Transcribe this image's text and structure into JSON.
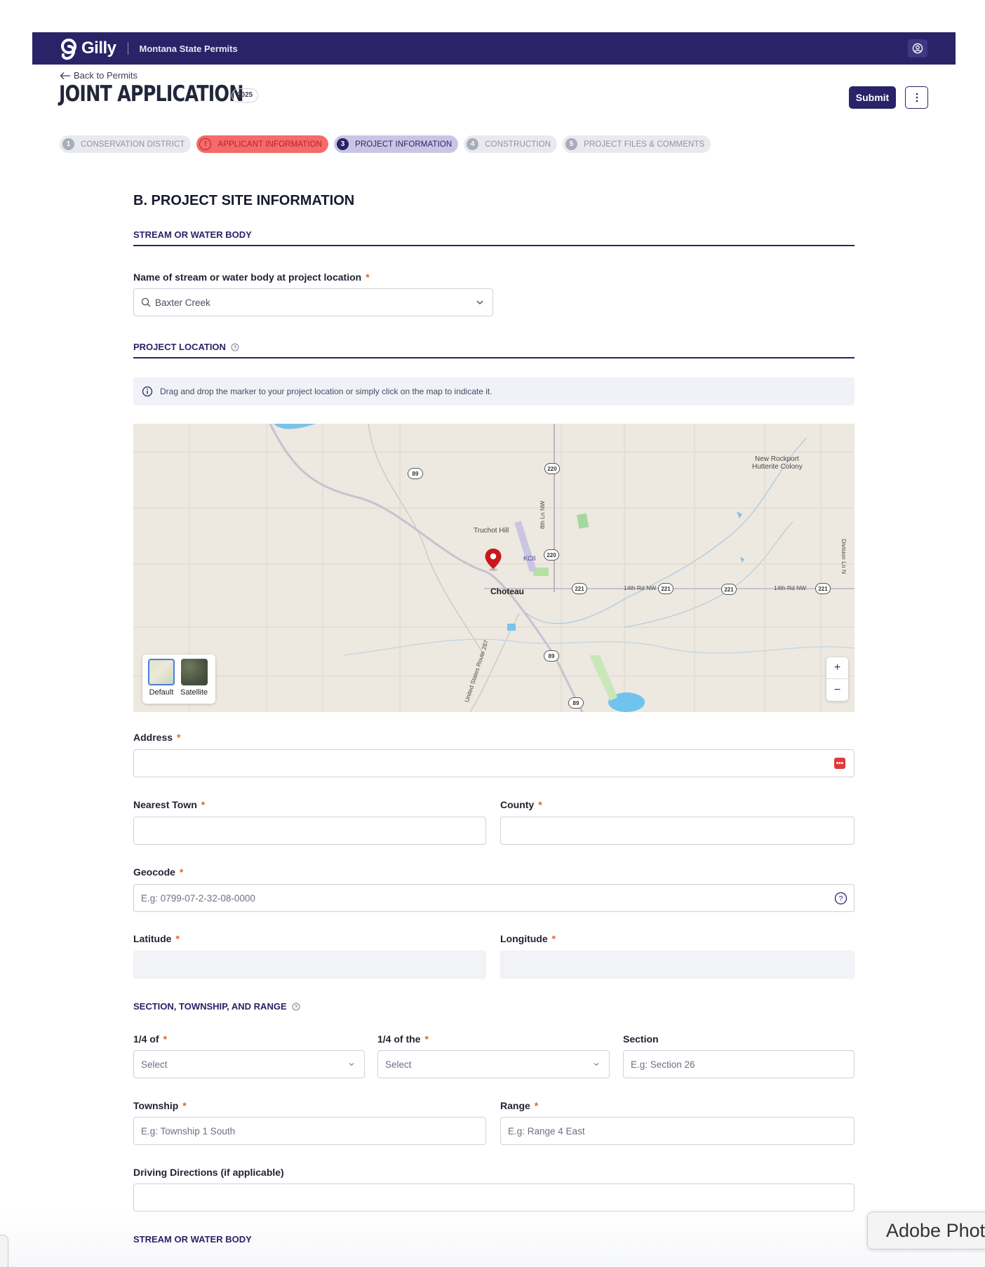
{
  "app": {
    "logo_text": "Gilly",
    "org_name": "Montana State Permits",
    "brand_color": "#2a2367",
    "user_icon": "user-circle-icon"
  },
  "header": {
    "back_label": "Back to Permits",
    "title": "JOINT APPLICATION",
    "year_badge": "2025",
    "submit_label": "Submit"
  },
  "steps": [
    {
      "num": "1",
      "label": "CONSERVATION DISTRICT",
      "state": "complete"
    },
    {
      "num": "!",
      "label": "APPLICANT INFORMATION",
      "state": "error"
    },
    {
      "num": "3",
      "label": "PROJECT INFORMATION",
      "state": "active"
    },
    {
      "num": "4",
      "label": "CONSTRUCTION",
      "state": "pending"
    },
    {
      "num": "5",
      "label": "PROJECT FILES & COMMENTS",
      "state": "pending"
    }
  ],
  "form": {
    "section_title": "B. PROJECT SITE INFORMATION",
    "stream_heading": "STREAM OR WATER BODY",
    "stream_label": "Name of stream or water body at project location",
    "stream_value": "Baxter Creek",
    "location_heading": "PROJECT LOCATION",
    "info_text": "Drag and drop the marker to your project location or simply click on the map to indicate it.",
    "address_label": "Address",
    "nearest_town_label": "Nearest Town",
    "county_label": "County",
    "geocode_label": "Geocode",
    "geocode_placeholder": "E.g: 0799-07-2-32-08-0000",
    "latitude_label": "Latitude",
    "longitude_label": "Longitude",
    "str_heading": "SECTION, TOWNSHIP, AND RANGE",
    "quarter_of_label": "1/4 of",
    "quarter_of_value": "Select",
    "quarter_of_the_label": "1/4 of the",
    "quarter_of_the_value": "Select",
    "section_label": "Section",
    "section_placeholder": "E.g: Section 26",
    "township_label": "Township",
    "township_placeholder": "E.g: Township 1 South",
    "range_label": "Range",
    "range_placeholder": "E.g: Range 4 East",
    "directions_label": "Driving Directions (if applicable)",
    "next_heading": "STREAM OR WATER BODY",
    "required_mark": "*"
  },
  "map": {
    "city": "Choteau",
    "labels": {
      "truchot": "Truchot Hill",
      "airport": "KCII",
      "new_rockport": "New Rockport",
      "hutterite": "Hutterite Colony",
      "road_14th": "14th Rd NW",
      "road_8th": "8th Ln NW",
      "division": "Division Ln N",
      "route287": "United States Route 287"
    },
    "shields": {
      "us89": "89",
      "mt220": "220",
      "mt221": "221"
    },
    "layer_default": "Default",
    "layer_satellite": "Satellite",
    "zoom_in": "+",
    "zoom_out": "−"
  },
  "overlay": {
    "adobe_label": "Adobe Photoshop"
  }
}
